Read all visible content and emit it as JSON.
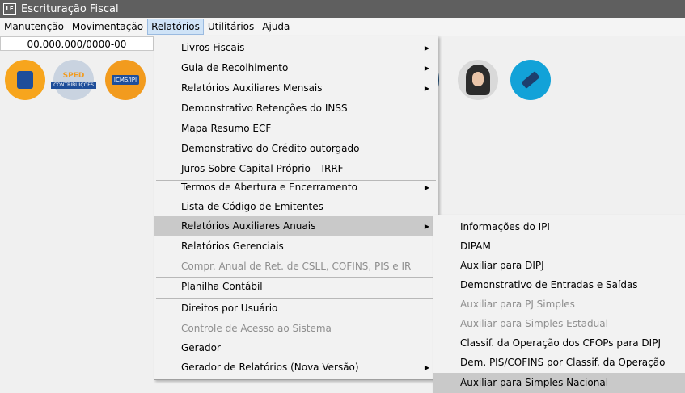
{
  "window": {
    "app_icon": "LF",
    "title": "Escrituração Fiscal"
  },
  "menubar": [
    "Manutenção",
    "Movimentação",
    "Relatórios",
    "Utilitários",
    "Ajuda"
  ],
  "cnpj_field": "00.000.000/0000-00",
  "toolbar": {
    "sped_top": "SPED",
    "sped_bottom": "CONTRIBUIÇÕES",
    "icms_ipi": "ICMS/IPI"
  },
  "relatorios_menu": [
    "Livros Fiscais",
    "Guia de Recolhimento",
    "Relatórios Auxiliares Mensais",
    "Demonstrativo Retenções do INSS",
    "Mapa Resumo ECF",
    "Demonstrativo do Crédito outorgado",
    "Juros Sobre Capital Próprio – IRRF",
    "Termos de Abertura e Encerramento",
    "Lista de Código de Emitentes",
    "Relatórios Auxiliares Anuais",
    "Relatórios Gerenciais",
    "Compr. Anual de Ret. de CSLL, COFINS,  PIS e IR",
    "Planilha Contábil",
    "Direitos por Usuário",
    "Controle de Acesso ao Sistema",
    "Gerador",
    "Gerador de Relatórios (Nova Versão)"
  ],
  "anuais_submenu": [
    "Informações do IPI",
    "DIPAM",
    "Auxiliar para DIPJ",
    "Demonstrativo de Entradas e Saídas",
    "Auxiliar para PJ Simples",
    "Auxiliar para Simples Estadual",
    "Classif. da Operação dos CFOPs para DIPJ",
    "Dem. PIS/COFINS por Classif. da Operação",
    "Auxiliar para Simples Nacional"
  ],
  "arrow_glyph": "▶"
}
